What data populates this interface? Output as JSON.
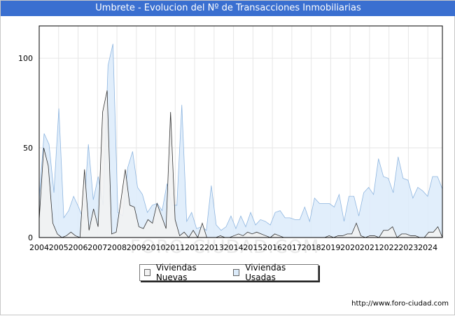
{
  "title": "Umbrete - Evolucion del Nº de Transacciones Inmobiliarias",
  "footer_url": "http://www.foro-ciudad.com",
  "watermark": "FORO-CIUDAD.COM",
  "colors": {
    "title_bg": "#3a6fd0",
    "nuevas_fill": "#f2f2f2",
    "nuevas_line": "#333333",
    "usadas_fill": "#dcebfa",
    "usadas_line": "#8fb6e0"
  },
  "chart_data": {
    "type": "area",
    "title": "Umbrete - Evolucion del Nº de Transacciones Inmobiliarias",
    "xlabel": "",
    "ylabel": "",
    "xlim": [
      2004,
      2024.75
    ],
    "ylim": [
      0,
      118
    ],
    "yticks": [
      0,
      50,
      100
    ],
    "grid": true,
    "legend_position": "bottom-center",
    "x_labels": [
      "2004",
      "2005",
      "2006",
      "2007",
      "2008",
      "2009",
      "2010",
      "2011",
      "2012",
      "2013",
      "2014",
      "2015",
      "2016",
      "2017",
      "2018",
      "2019",
      "2020",
      "2021",
      "2022",
      "2023",
      "2024"
    ],
    "series": [
      {
        "name": "Viviendas Nuevas",
        "values": [
          10,
          50,
          40,
          8,
          2,
          0,
          1,
          3,
          1,
          0,
          38,
          4,
          16,
          6,
          70,
          82,
          2,
          3,
          20,
          38,
          18,
          17,
          6,
          5,
          10,
          8,
          19,
          12,
          5,
          70,
          10,
          1,
          3,
          0,
          4,
          0,
          8,
          0,
          0,
          0,
          1,
          0,
          0,
          1,
          2,
          1,
          3,
          2,
          3,
          2,
          1,
          0,
          2,
          1,
          0,
          0,
          0,
          0,
          0,
          0,
          0,
          0,
          0,
          0,
          1,
          0,
          1,
          1,
          2,
          2,
          8,
          1,
          0,
          1,
          1,
          0,
          4,
          4,
          6,
          0,
          2,
          2,
          1,
          1,
          0,
          0,
          3,
          3,
          6,
          0
        ]
      },
      {
        "name": "Viviendas Usadas",
        "values": [
          22,
          58,
          52,
          25,
          72,
          11,
          15,
          23,
          17,
          10,
          52,
          21,
          34,
          18,
          96,
          108,
          14,
          12,
          39,
          48,
          28,
          24,
          14,
          18,
          19,
          15,
          30,
          18,
          18,
          74,
          9,
          14,
          5,
          6,
          4,
          29,
          7,
          4,
          6,
          12,
          5,
          12,
          6,
          14,
          7,
          10,
          9,
          7,
          14,
          15,
          11,
          11,
          10,
          10,
          17,
          9,
          22,
          19,
          19,
          19,
          17,
          24,
          9,
          23,
          23,
          12,
          25,
          28,
          24,
          44,
          34,
          33,
          25,
          45,
          33,
          32,
          22,
          28,
          26,
          23,
          34,
          34,
          27
        ]
      }
    ]
  }
}
